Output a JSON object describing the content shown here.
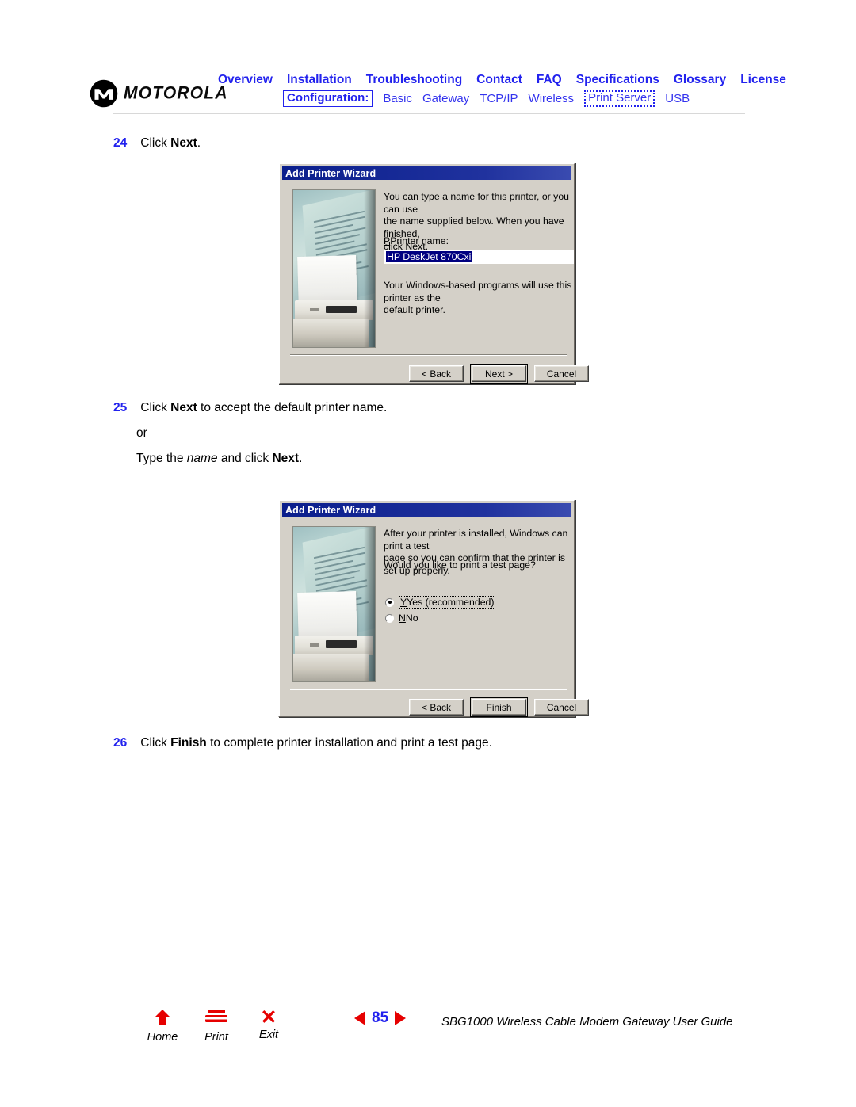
{
  "header": {
    "brand": "MOTOROLA",
    "logo_icon": "motorola-m-logo",
    "primary_nav": [
      {
        "label": "Overview"
      },
      {
        "label": "Installation"
      },
      {
        "label": "Troubleshooting"
      },
      {
        "label": "Contact"
      },
      {
        "label": "FAQ"
      },
      {
        "label": "Specifications"
      },
      {
        "label": "Glossary"
      },
      {
        "label": "License"
      }
    ],
    "config_label": "Configuration:",
    "secondary_nav": [
      {
        "label": "Basic"
      },
      {
        "label": "Gateway"
      },
      {
        "label": "TCP/IP"
      },
      {
        "label": "Wireless"
      },
      {
        "label": "Print Server"
      },
      {
        "label": "USB"
      }
    ],
    "active_secondary": "Print Server"
  },
  "steps": {
    "s24_num": "24",
    "s24_pre": "Click ",
    "s24_bold": "Next",
    "s24_post": ".",
    "s25_num": "25",
    "s25_pre": "Click ",
    "s25_bold": "Next",
    "s25_post": " to accept the default printer name.",
    "s25_or": "or",
    "s25_alt_pre": "Type the ",
    "s25_alt_italic": "name",
    "s25_alt_mid": " and click ",
    "s25_alt_bold": "Next",
    "s25_alt_post": ".",
    "s26_num": "26",
    "s26_pre": "Click ",
    "s26_bold": "Finish",
    "s26_post": " to complete printer installation and print a test page."
  },
  "dialog1": {
    "title": "Add Printer Wizard",
    "body_line1": "You can type a name for this printer, or you can use",
    "body_line2": "the name supplied below. When you have finished,",
    "body_line3": "click Next.",
    "field_label": "Printer name:",
    "field_value": "HP DeskJet 870Cxi",
    "note_line1": "Your Windows-based programs will use this printer as the",
    "note_line2": "default printer.",
    "buttons": [
      {
        "label": "< Back",
        "default": false
      },
      {
        "label": "Next >",
        "default": true
      },
      {
        "label": "Cancel",
        "default": false
      }
    ]
  },
  "dialog2": {
    "title": "Add Printer Wizard",
    "body_line1": "After your printer is installed, Windows can print a test",
    "body_line2": "page so you can confirm that the printer is set up properly.",
    "question": "Would you like to print a test page?",
    "options": [
      {
        "label": "Yes (recommended)",
        "selected": true
      },
      {
        "label": "No",
        "selected": false
      }
    ],
    "buttons": [
      {
        "label": "< Back",
        "default": false
      },
      {
        "label": "Finish",
        "default": true
      },
      {
        "label": "Cancel",
        "default": false
      }
    ]
  },
  "footer": {
    "home_label": "Home",
    "print_label": "Print",
    "exit_label": "Exit",
    "page_number": "85",
    "guide_title": "SBG1000 Wireless Cable Modem Gateway User Guide"
  },
  "colors": {
    "link_blue": "#2222ee",
    "accent_red": "#e60000",
    "dialog_face": "#d4d0c8",
    "titlebar_blue": "#0a1e8c"
  }
}
